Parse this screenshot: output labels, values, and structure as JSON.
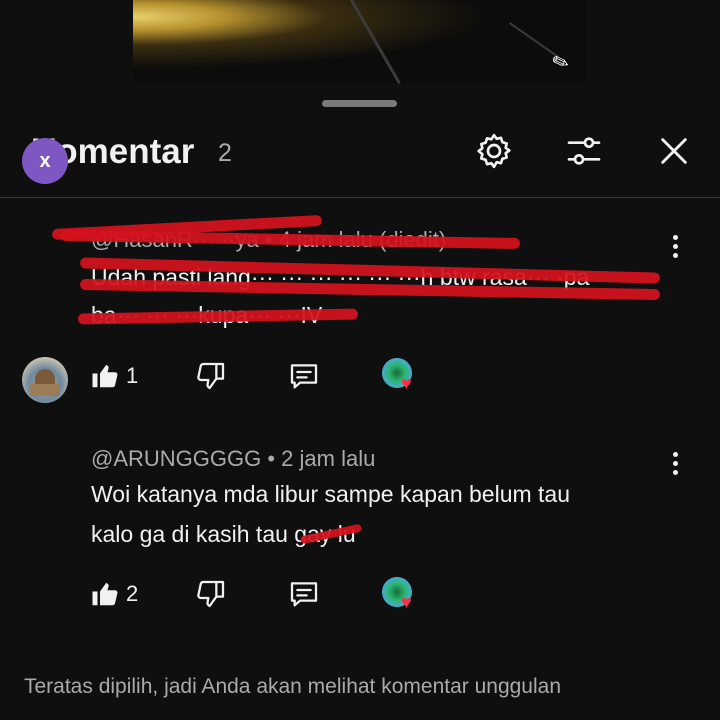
{
  "header": {
    "title": "Komentar",
    "count": "2"
  },
  "comments": [
    {
      "avatar_letter": "x",
      "meta": "@HasanR··· ··ya • 4 jam lalu (diedit)",
      "text_line1": "Udah pasti lang··· ··· ··· ··· ··· ···h btw rasa··· ·pa",
      "text_line2": "ba··· ··· ···kupa··· ···IV",
      "likes": "1",
      "redacted": true
    },
    {
      "meta": "@ARUNGGGGG • 2 jam lalu",
      "text_line1": "Woi katanya mda libur sampe kapan belum tau",
      "text_line2": "kalo ga di kasih tau gay lu",
      "likes": "2",
      "redacted": false
    }
  ],
  "footer": {
    "note": "Teratas dipilih, jadi Anda akan melihat komentar unggulan"
  },
  "colors": {
    "background": "#0f0f0f",
    "text": "#f1f1f1",
    "secondary": "#aaaaaa",
    "avatar_x": "#7e57c2",
    "heart": "#ff2d4a",
    "redaction": "#d4121e"
  },
  "icons": {
    "settings": "gear-icon",
    "filter": "sliders-icon",
    "close": "close-icon",
    "like": "thumbs-up-icon",
    "dislike": "thumbs-down-icon",
    "reply": "reply-icon",
    "creator_heart": "creator-heart-icon",
    "more": "kebab-icon"
  }
}
